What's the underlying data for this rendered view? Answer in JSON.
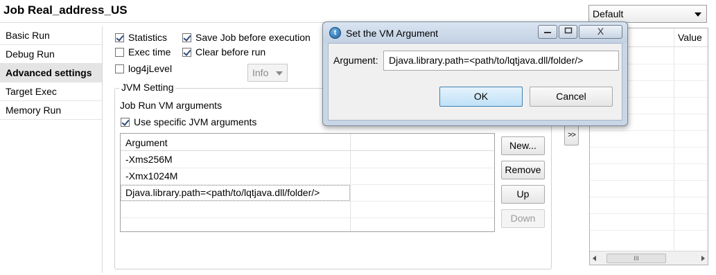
{
  "job": {
    "title": "Job Real_address_US"
  },
  "nav": {
    "items": [
      {
        "label": "Basic Run",
        "active": false
      },
      {
        "label": "Debug Run",
        "active": false
      },
      {
        "label": "Advanced settings",
        "active": true
      },
      {
        "label": "Target Exec",
        "active": false
      },
      {
        "label": "Memory Run",
        "active": false
      }
    ]
  },
  "options": {
    "statistics": {
      "label": "Statistics",
      "checked": true
    },
    "save_job": {
      "label": "Save Job before execution",
      "checked": true
    },
    "exec_time": {
      "label": "Exec time",
      "checked": false
    },
    "clear_before_run": {
      "label": "Clear before run",
      "checked": true
    },
    "log4j": {
      "label": "log4jLevel",
      "checked": false
    },
    "log_level_value": "Info"
  },
  "jvm": {
    "group_label": "JVM Setting",
    "job_run_vm_label": "Job Run VM arguments",
    "use_specific": {
      "label": "Use specific JVM arguments",
      "checked": true
    },
    "table": {
      "header": "Argument",
      "rows": [
        "-Xms256M",
        "-Xmx1024M",
        "Djava.library.path=<path/to/lqtjava.dll/folder/>"
      ]
    },
    "buttons": {
      "new": "New...",
      "remove": "Remove",
      "up": "Up",
      "down": "Down"
    }
  },
  "right_panel": {
    "context_select": "Default",
    "value_header": "Value",
    "transfer_label": ">>",
    "scroll_thumb": "III"
  },
  "dialog": {
    "title": "Set the VM Argument",
    "argument_label": "Argument:",
    "argument_value": "Djava.library.path=<path/to/lqtjava.dll/folder/>",
    "ok": "OK",
    "cancel": "Cancel",
    "window_close": "X"
  }
}
